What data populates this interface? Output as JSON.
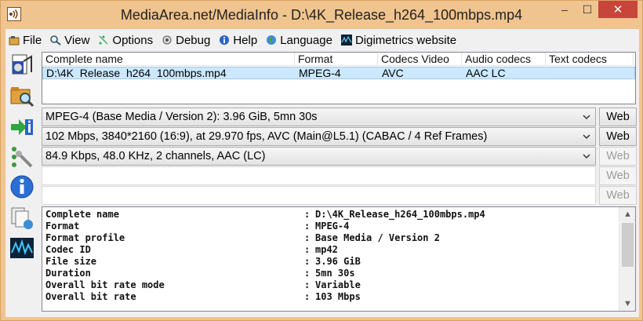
{
  "window": {
    "title": "MediaArea.net/MediaInfo - D:\\4K_Release_h264_100mbps.mp4",
    "minimize_label": "–",
    "maximize_label": "☐",
    "close_label": "✕"
  },
  "menu": {
    "items": [
      {
        "label": "File",
        "icon": "file-icon"
      },
      {
        "label": "View",
        "icon": "view-icon"
      },
      {
        "label": "Options",
        "icon": "options-icon"
      },
      {
        "label": "Debug",
        "icon": "debug-icon"
      },
      {
        "label": "Help",
        "icon": "help-icon"
      },
      {
        "label": "Language",
        "icon": "language-icon"
      },
      {
        "label": "Digimetrics website",
        "icon": "digimetrics-icon"
      }
    ]
  },
  "toolbar": {
    "buttons": [
      "open-file-icon",
      "open-folder-icon",
      "export-icon",
      "preferences-icon",
      "about-icon",
      "sheet-icon",
      "digimetrics-logo-icon"
    ]
  },
  "file_list": {
    "columns": [
      "Complete name",
      "Format",
      "Codecs Video",
      "Audio codecs",
      "Text codecs"
    ],
    "rows": [
      [
        "D:\\4K_Release_h264_100mbps.mp4",
        "MPEG-4",
        "AVC",
        "AAC LC",
        ""
      ]
    ]
  },
  "streams": [
    {
      "text": "MPEG-4 (Base Media / Version 2): 3.96 GiB, 5mn 30s",
      "web": "Web",
      "web_enabled": true
    },
    {
      "text": "102 Mbps, 3840*2160 (16:9), at 29.970 fps, AVC (Main@L5.1) (CABAC / 4 Ref Frames)",
      "web": "Web",
      "web_enabled": true
    },
    {
      "text": "84.9 Kbps, 48.0 KHz, 2 channels, AAC (LC)",
      "web": "Web",
      "web_enabled": false
    },
    {
      "text": "",
      "web": "Web",
      "web_enabled": false
    },
    {
      "text": "",
      "web": "Web",
      "web_enabled": false
    }
  ],
  "details": [
    {
      "key": "Complete name",
      "value": "D:\\4K_Release_h264_100mbps.mp4"
    },
    {
      "key": "Format",
      "value": "MPEG-4"
    },
    {
      "key": "Format profile",
      "value": "Base Media / Version 2"
    },
    {
      "key": "Codec ID",
      "value": "mp42"
    },
    {
      "key": "File size",
      "value": "3.96 GiB"
    },
    {
      "key": "Duration",
      "value": "5mn 30s"
    },
    {
      "key": "Overall bit rate mode",
      "value": "Variable"
    },
    {
      "key": "Overall bit rate",
      "value": "103 Mbps"
    }
  ],
  "colors": {
    "title_bar": "#f0c48f",
    "close_button": "#c7453a",
    "selection": "#cce8ff"
  }
}
